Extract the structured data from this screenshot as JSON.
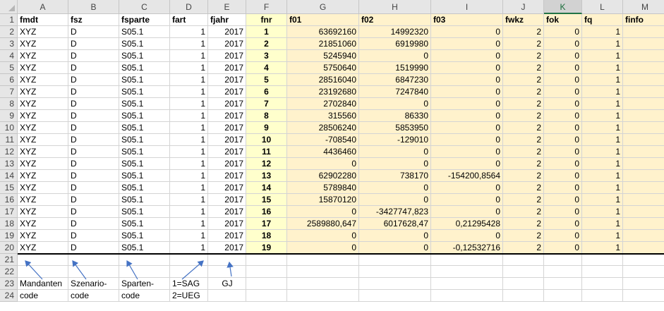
{
  "columns": [
    "A",
    "B",
    "C",
    "D",
    "E",
    "F",
    "G",
    "H",
    "I",
    "J",
    "K",
    "L",
    "M"
  ],
  "selected_column": "K",
  "row_numbers": [
    1,
    2,
    3,
    4,
    5,
    6,
    7,
    8,
    9,
    10,
    11,
    12,
    13,
    14,
    15,
    16,
    17,
    18,
    19,
    20,
    21,
    22,
    23,
    24
  ],
  "header_row": [
    "fmdt",
    "fsz",
    "fsparte",
    "fart",
    "fjahr",
    "fnr",
    "f01",
    "f02",
    "f03",
    "fwkz",
    "fok",
    "fq",
    "finfo"
  ],
  "data_rows": [
    [
      "XYZ",
      "D",
      "S05.1",
      "1",
      "2017",
      "1",
      "63692160",
      "14992320",
      "0",
      "2",
      "0",
      "1",
      ""
    ],
    [
      "XYZ",
      "D",
      "S05.1",
      "1",
      "2017",
      "2",
      "21851060",
      "6919980",
      "0",
      "2",
      "0",
      "1",
      ""
    ],
    [
      "XYZ",
      "D",
      "S05.1",
      "1",
      "2017",
      "3",
      "5245940",
      "0",
      "0",
      "2",
      "0",
      "1",
      ""
    ],
    [
      "XYZ",
      "D",
      "S05.1",
      "1",
      "2017",
      "4",
      "5750640",
      "1519990",
      "0",
      "2",
      "0",
      "1",
      ""
    ],
    [
      "XYZ",
      "D",
      "S05.1",
      "1",
      "2017",
      "5",
      "28516040",
      "6847230",
      "0",
      "2",
      "0",
      "1",
      ""
    ],
    [
      "XYZ",
      "D",
      "S05.1",
      "1",
      "2017",
      "6",
      "23192680",
      "7247840",
      "0",
      "2",
      "0",
      "1",
      ""
    ],
    [
      "XYZ",
      "D",
      "S05.1",
      "1",
      "2017",
      "7",
      "2702840",
      "0",
      "0",
      "2",
      "0",
      "1",
      ""
    ],
    [
      "XYZ",
      "D",
      "S05.1",
      "1",
      "2017",
      "8",
      "315560",
      "86330",
      "0",
      "2",
      "0",
      "1",
      ""
    ],
    [
      "XYZ",
      "D",
      "S05.1",
      "1",
      "2017",
      "9",
      "28506240",
      "5853950",
      "0",
      "2",
      "0",
      "1",
      ""
    ],
    [
      "XYZ",
      "D",
      "S05.1",
      "1",
      "2017",
      "10",
      "-708540",
      "-129010",
      "0",
      "2",
      "0",
      "1",
      ""
    ],
    [
      "XYZ",
      "D",
      "S05.1",
      "1",
      "2017",
      "11",
      "4436460",
      "0",
      "0",
      "2",
      "0",
      "1",
      ""
    ],
    [
      "XYZ",
      "D",
      "S05.1",
      "1",
      "2017",
      "12",
      "0",
      "0",
      "0",
      "2",
      "0",
      "1",
      ""
    ],
    [
      "XYZ",
      "D",
      "S05.1",
      "1",
      "2017",
      "13",
      "62902280",
      "738170",
      "-154200,8564",
      "2",
      "0",
      "1",
      ""
    ],
    [
      "XYZ",
      "D",
      "S05.1",
      "1",
      "2017",
      "14",
      "5789840",
      "0",
      "0",
      "2",
      "0",
      "1",
      ""
    ],
    [
      "XYZ",
      "D",
      "S05.1",
      "1",
      "2017",
      "15",
      "15870120",
      "0",
      "0",
      "2",
      "0",
      "1",
      ""
    ],
    [
      "XYZ",
      "D",
      "S05.1",
      "1",
      "2017",
      "16",
      "0",
      "-3427747,823",
      "0",
      "2",
      "0",
      "1",
      ""
    ],
    [
      "XYZ",
      "D",
      "S05.1",
      "1",
      "2017",
      "17",
      "2589880,647",
      "6017628,47",
      "0,21295428",
      "2",
      "0",
      "1",
      ""
    ],
    [
      "XYZ",
      "D",
      "S05.1",
      "1",
      "2017",
      "18",
      "0",
      "0",
      "0",
      "2",
      "0",
      "1",
      ""
    ],
    [
      "XYZ",
      "D",
      "S05.1",
      "1",
      "2017",
      "19",
      "0",
      "0",
      "-0,12532716",
      "2",
      "0",
      "1",
      ""
    ]
  ],
  "annotations": {
    "mandant": {
      "line1": "Mandanten",
      "line2": "code"
    },
    "szenario": {
      "line1": "Szenario-",
      "line2": "code"
    },
    "sparte": {
      "line1": "Sparten-",
      "line2": "code"
    },
    "art": {
      "line1": "1=SAG",
      "line2": "2=UEG"
    },
    "jahr": {
      "line1": "GJ"
    }
  },
  "colors": {
    "fnr_fill": "#ffffcc",
    "values_fill": "#fff2cc",
    "header_bg": "#e6e6e6",
    "selected_header": "#217346",
    "arrow": "#4472c4"
  }
}
